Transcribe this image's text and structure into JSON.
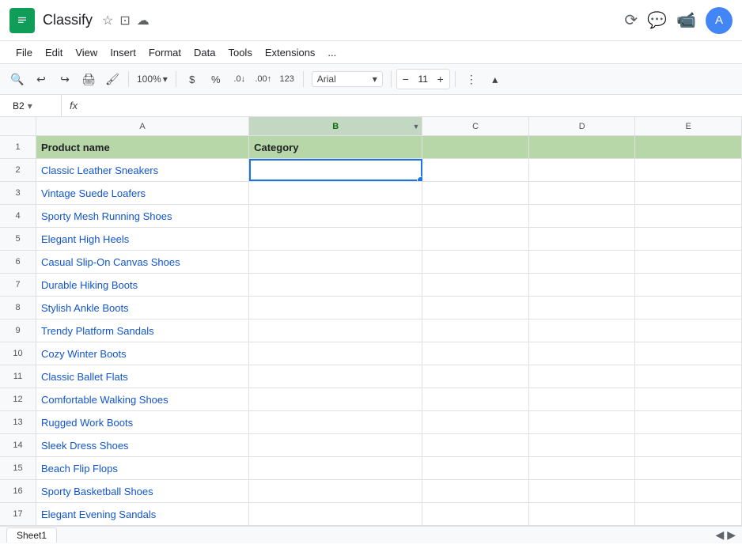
{
  "app": {
    "icon_letter": "S",
    "title": "Classify",
    "starred": "★",
    "drive_icon": "⬜",
    "cloud_icon": "☁"
  },
  "menu": {
    "items": [
      "File",
      "Edit",
      "View",
      "Insert",
      "Format",
      "Data",
      "Tools",
      "Extensions",
      "..."
    ]
  },
  "toolbar": {
    "zoom": "100%",
    "font": "Arial",
    "font_size": "11",
    "more_label": "⋮",
    "chevron": "▾",
    "chevron_up": "▴"
  },
  "formula_bar": {
    "cell_ref": "B2",
    "fx_label": "fx"
  },
  "columns": {
    "row_header": "",
    "headers": [
      "A",
      "B",
      "C",
      "D",
      "E"
    ]
  },
  "rows": [
    {
      "num": "1",
      "a": "Product name",
      "b": "Category",
      "is_header": true
    },
    {
      "num": "2",
      "a": "Classic Leather Sneakers",
      "b": "",
      "selected_b": true
    },
    {
      "num": "3",
      "a": "Vintage Suede Loafers",
      "b": ""
    },
    {
      "num": "4",
      "a": "Sporty Mesh Running Shoes",
      "b": ""
    },
    {
      "num": "5",
      "a": "Elegant High Heels",
      "b": ""
    },
    {
      "num": "6",
      "a": "Casual Slip-On Canvas Shoes",
      "b": ""
    },
    {
      "num": "7",
      "a": "Durable Hiking Boots",
      "b": ""
    },
    {
      "num": "8",
      "a": "Stylish Ankle Boots",
      "b": ""
    },
    {
      "num": "9",
      "a": "Trendy Platform Sandals",
      "b": ""
    },
    {
      "num": "10",
      "a": "Cozy Winter Boots",
      "b": ""
    },
    {
      "num": "11",
      "a": "Classic Ballet Flats",
      "b": ""
    },
    {
      "num": "12",
      "a": "Comfortable Walking Shoes",
      "b": ""
    },
    {
      "num": "13",
      "a": "Rugged Work Boots",
      "b": ""
    },
    {
      "num": "14",
      "a": "Sleek Dress Shoes",
      "b": ""
    },
    {
      "num": "15",
      "a": "Beach Flip Flops",
      "b": ""
    },
    {
      "num": "16",
      "a": "Sporty Basketball Shoes",
      "b": ""
    },
    {
      "num": "17",
      "a": "Elegant Evening Sandals",
      "b": ""
    }
  ],
  "sheet_tab": "Sheet1",
  "colors": {
    "header_bg": "#b7d7a8",
    "selected_col_bg": "#c3d8c3",
    "link_color": "#1155cc",
    "selected_border": "#1a73e8"
  }
}
